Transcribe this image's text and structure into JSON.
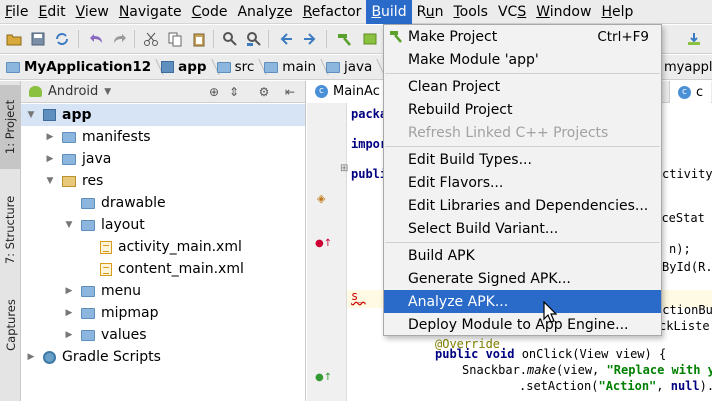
{
  "menubar": {
    "items": [
      {
        "label": "File",
        "mnemonic": "F"
      },
      {
        "label": "Edit",
        "mnemonic": "E"
      },
      {
        "label": "View",
        "mnemonic": "V"
      },
      {
        "label": "Navigate",
        "mnemonic": "N"
      },
      {
        "label": "Code",
        "mnemonic": "C"
      },
      {
        "label": "Analyze",
        "mnemonic": "z"
      },
      {
        "label": "Refactor",
        "mnemonic": "R"
      },
      {
        "label": "Build",
        "mnemonic": "B"
      },
      {
        "label": "Run",
        "mnemonic": "u"
      },
      {
        "label": "Tools",
        "mnemonic": "T"
      },
      {
        "label": "VCS",
        "mnemonic": "S"
      },
      {
        "label": "Window",
        "mnemonic": "W"
      },
      {
        "label": "Help",
        "mnemonic": "H"
      }
    ],
    "active": "Build"
  },
  "breadcrumb": [
    {
      "label": "MyApplication12",
      "icon": "folder-icon",
      "bold": true
    },
    {
      "label": "app",
      "icon": "module-icon",
      "bold": true
    },
    {
      "label": "src",
      "icon": "folder-icon",
      "bold": false
    },
    {
      "label": "main",
      "icon": "folder-icon",
      "bold": false
    },
    {
      "label": "java",
      "icon": "folder-icon",
      "bold": false
    }
  ],
  "breadcrumb_right": "myapplic",
  "leftstrip": {
    "project_tab": "1: Project",
    "structure_tab": "7: Structure",
    "captures_tab": "Captures"
  },
  "project": {
    "view_mode": "Android",
    "tree": [
      {
        "label": "app",
        "icon": "module-folder-icon",
        "depth": 0,
        "expanded": true,
        "bold": true
      },
      {
        "label": "manifests",
        "icon": "folder-icon",
        "depth": 1,
        "expanded": false
      },
      {
        "label": "java",
        "icon": "folder-icon",
        "depth": 1,
        "expanded": false
      },
      {
        "label": "res",
        "icon": "res-folder-icon",
        "depth": 1,
        "expanded": true
      },
      {
        "label": "drawable",
        "icon": "folder-icon",
        "depth": 2,
        "expanded": null
      },
      {
        "label": "layout",
        "icon": "folder-icon",
        "depth": 2,
        "expanded": true
      },
      {
        "label": "activity_main.xml",
        "icon": "xml-file-icon",
        "depth": 3,
        "expanded": null
      },
      {
        "label": "content_main.xml",
        "icon": "xml-file-icon",
        "depth": 3,
        "expanded": null
      },
      {
        "label": "menu",
        "icon": "folder-icon",
        "depth": 2,
        "expanded": false
      },
      {
        "label": "mipmap",
        "icon": "folder-icon",
        "depth": 2,
        "expanded": false
      },
      {
        "label": "values",
        "icon": "folder-icon",
        "depth": 2,
        "expanded": false
      },
      {
        "label": "Gradle Scripts",
        "icon": "gradle-icon",
        "depth": 0,
        "expanded": false
      }
    ]
  },
  "editor": {
    "active_tab": "MainAc",
    "right_tab": "c",
    "code": [
      {
        "text": "packa",
        "cls": "kw"
      },
      {
        "text": "impor",
        "cls": "kw"
      },
      {
        "text": "publi",
        "cls": "kw"
      },
      {
        "text": "ctivity",
        "cls": ""
      },
      {
        "text": "anceStat",
        "cls": ""
      },
      {
        "text": "n);",
        "cls": ""
      },
      {
        "text": "ById(R.i",
        "cls": ""
      },
      {
        "text": "s_",
        "cls": "err"
      },
      {
        "text": "ActionBu",
        "cls": ""
      },
      {
        "text": "ckListe",
        "cls": ""
      },
      {
        "text": "@Override",
        "cls": "ann"
      },
      {
        "text": "public void onClick(View view) {",
        "cls": "mixed"
      },
      {
        "text": "Snackbar.make(view, \"Replace with yo",
        "cls": "mixed2"
      },
      {
        "text": ".setAction(\"Action\", null).s",
        "cls": "mixed3"
      }
    ]
  },
  "build_menu": {
    "items": [
      {
        "label": "Make Project",
        "shortcut": "Ctrl+F9",
        "disabled": false,
        "hover": false
      },
      {
        "label": "Make Module 'app'",
        "shortcut": "",
        "disabled": false,
        "hover": false
      },
      {
        "label": "Clean Project",
        "shortcut": "",
        "disabled": false,
        "hover": false
      },
      {
        "label": "Rebuild Project",
        "shortcut": "",
        "disabled": false,
        "hover": false
      },
      {
        "label": "Refresh Linked C++ Projects",
        "shortcut": "",
        "disabled": true,
        "hover": false
      },
      {
        "label": "Edit Build Types...",
        "shortcut": "",
        "disabled": false,
        "hover": false
      },
      {
        "label": "Edit Flavors...",
        "shortcut": "",
        "disabled": false,
        "hover": false
      },
      {
        "label": "Edit Libraries and Dependencies...",
        "shortcut": "",
        "disabled": false,
        "hover": false
      },
      {
        "label": "Select Build Variant...",
        "shortcut": "",
        "disabled": false,
        "hover": false
      },
      {
        "label": "Build APK",
        "shortcut": "",
        "disabled": false,
        "hover": false
      },
      {
        "label": "Generate Signed APK...",
        "shortcut": "",
        "disabled": false,
        "hover": false
      },
      {
        "label": "Analyze APK...",
        "shortcut": "",
        "disabled": false,
        "hover": true
      },
      {
        "label": "Deploy Module to App Engine...",
        "shortcut": "",
        "disabled": false,
        "hover": false
      }
    ]
  },
  "colors": {
    "menu_highlight": "#2a6ac8",
    "selection": "#d6e4f6",
    "keyword": "#000080",
    "string": "#008000",
    "annotation": "#808000"
  }
}
